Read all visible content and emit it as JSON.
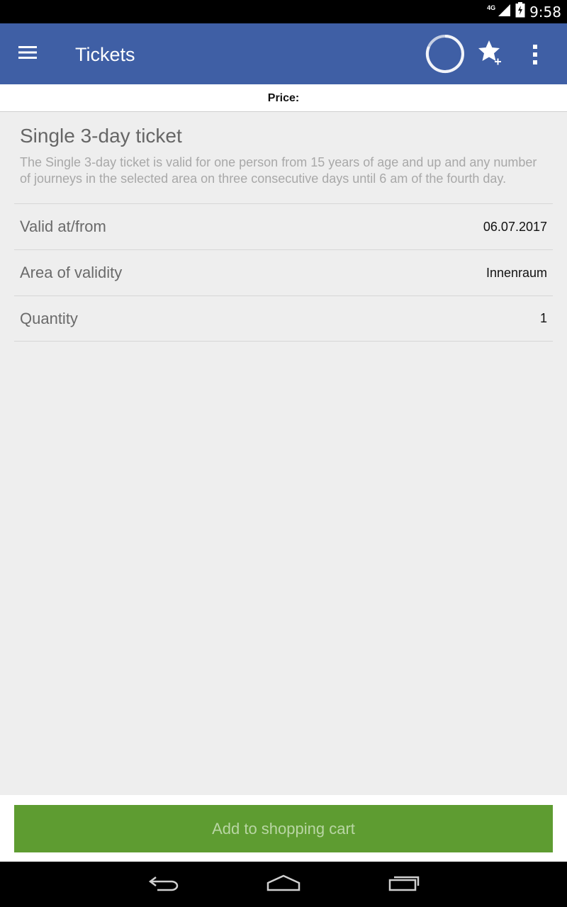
{
  "status_bar": {
    "network": "4G",
    "time": "9:58",
    "icons": [
      "signal-icon",
      "battery-icon"
    ]
  },
  "app_bar": {
    "title": "Tickets",
    "icons": [
      "menu-icon",
      "loading-spinner-icon",
      "favorite-add-icon",
      "overflow-menu-icon"
    ],
    "color": "#3f5fa5"
  },
  "price": {
    "label": "Price:"
  },
  "ticket": {
    "title": "Single 3-day ticket",
    "description": "The Single 3-day ticket is valid for one person from 15 years of age and up and any number of journeys in the selected area on three consecutive days until 6 am of the fourth day."
  },
  "details": [
    {
      "label": "Valid at/from",
      "value": "06.07.2017"
    },
    {
      "label": "Area of validity",
      "value": "Innenraum"
    },
    {
      "label": "Quantity",
      "value": "1"
    }
  ],
  "cart_button": {
    "label": "Add to shopping cart",
    "color": "#5e9c31"
  },
  "nav_bar": {
    "icons": [
      "back-icon",
      "home-icon",
      "recent-apps-icon"
    ]
  }
}
